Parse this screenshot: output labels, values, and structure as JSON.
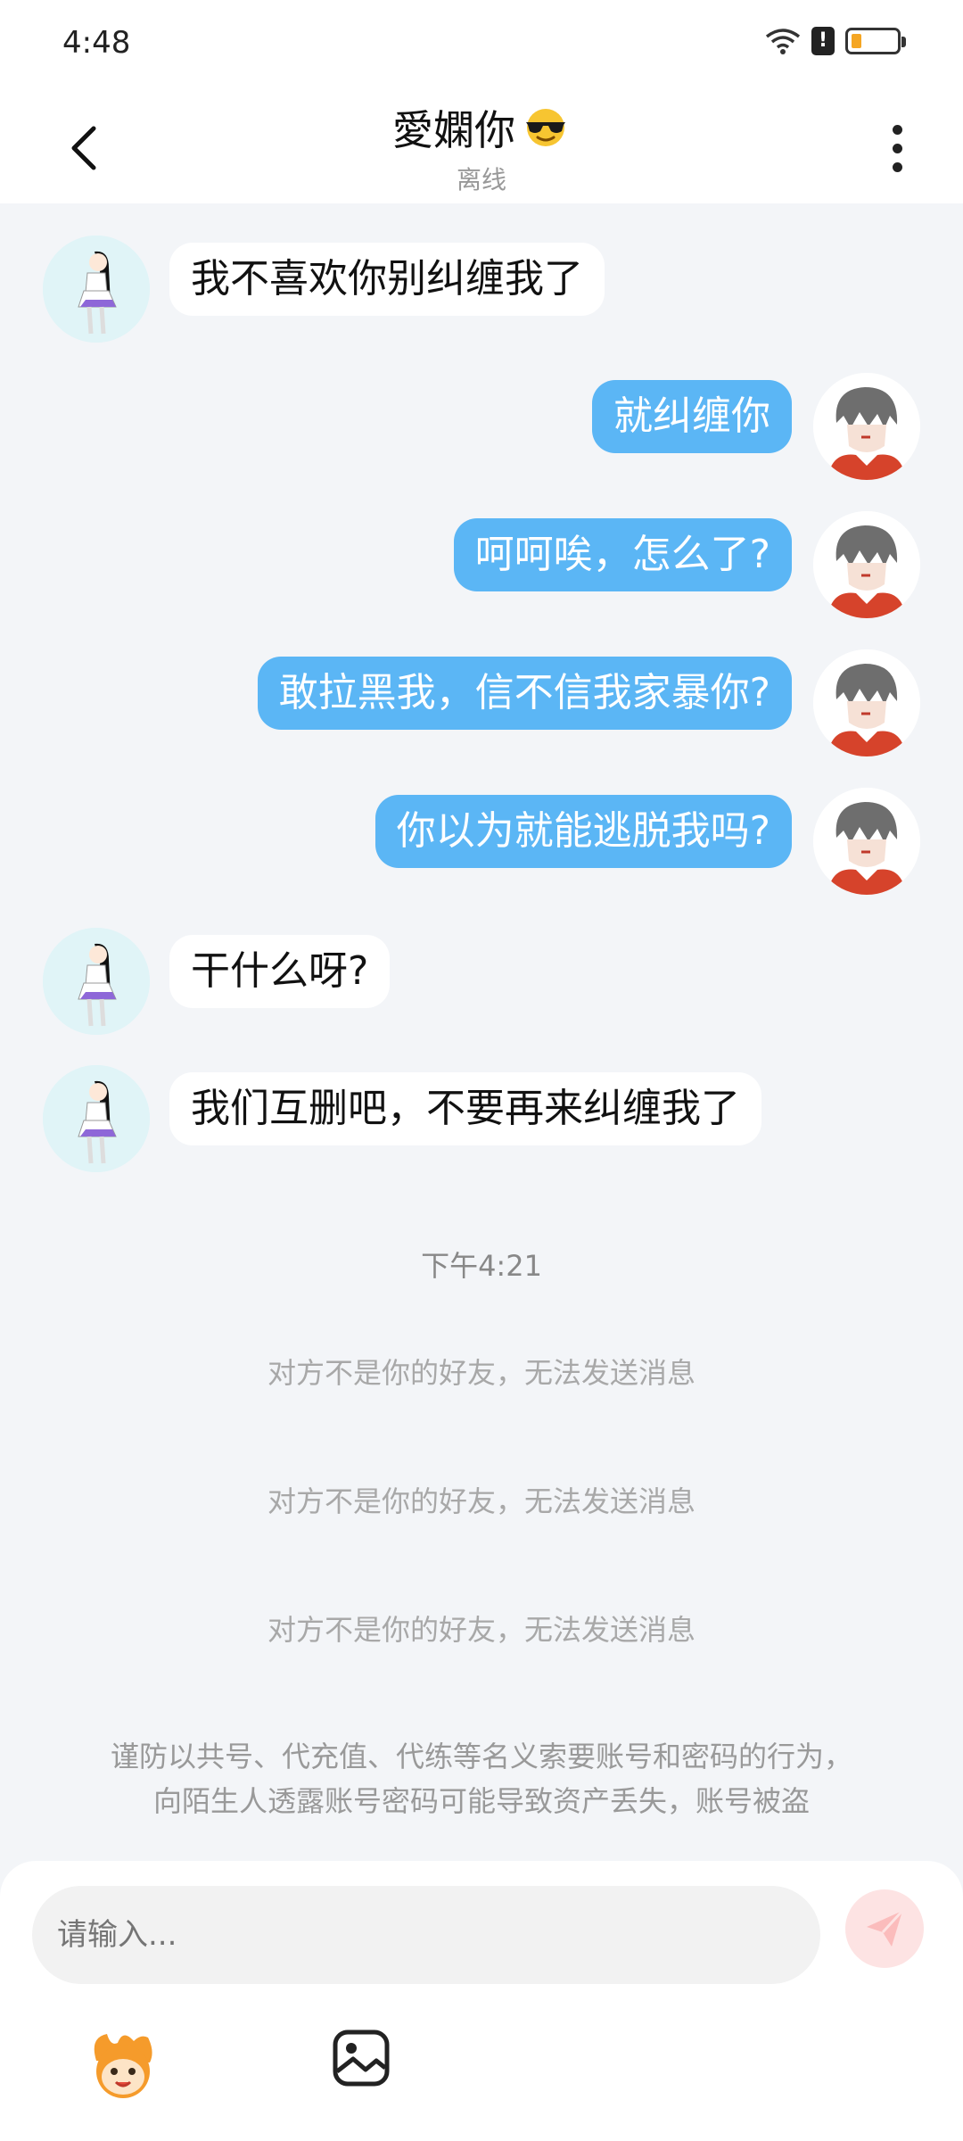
{
  "status_bar": {
    "time": "4:48"
  },
  "header": {
    "title": "愛嫻你",
    "title_emoji_icon": "sunglasses-emoji-icon",
    "subtitle": "离线"
  },
  "messages": [
    {
      "side": "left",
      "text": "我不喜欢你别纠缠我了"
    },
    {
      "side": "right",
      "text": "就纠缠你"
    },
    {
      "side": "right",
      "text": "呵呵唉，怎么了?"
    },
    {
      "side": "right",
      "text": "敢拉黑我，信不信我家暴你?"
    },
    {
      "side": "right",
      "text": "你以为就能逃脱我吗?"
    },
    {
      "side": "left",
      "text": "干什么呀?"
    },
    {
      "side": "left",
      "text": "我们互删吧，不要再来纠缠我了"
    }
  ],
  "timestamp": "下午4:21",
  "system_messages": [
    "对方不是你的好友，无法发送消息",
    "对方不是你的好友，无法发送消息",
    "对方不是你的好友，无法发送消息"
  ],
  "warning": {
    "line1": "谨防以共号、代充值、代练等名义索要账号和密码的行为，",
    "line2": "向陌生人透露账号密码可能导致资产丢失，账号被盗"
  },
  "input": {
    "placeholder": "请输入..."
  },
  "colors": {
    "outgoing_bubble": "#5bb6f5",
    "incoming_bubble": "#ffffff",
    "background": "#f3f5f8",
    "send_button": "#fde3e3"
  },
  "icons": {
    "back": "back-arrow-icon",
    "more": "more-vertical-icon",
    "send": "send-icon",
    "emoji": "emoji-face-icon",
    "image": "image-icon"
  }
}
